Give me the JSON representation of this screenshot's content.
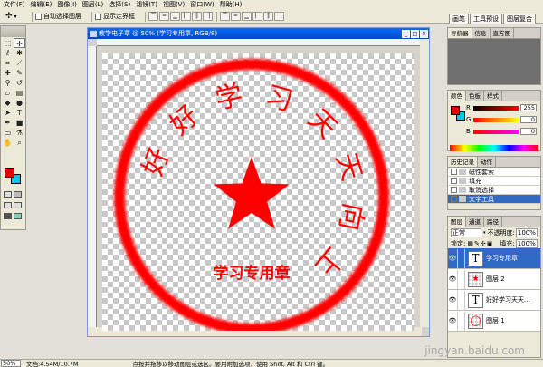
{
  "menubar": {
    "items": [
      "文件(F)",
      "编辑(E)",
      "图像(I)",
      "图层(L)",
      "选择(S)",
      "滤镜(T)",
      "视图(V)",
      "窗口(W)",
      "帮助(H)"
    ]
  },
  "options": {
    "auto_select_label": "自动选择图层",
    "show_bounds_label": "显示定界框"
  },
  "well": {
    "tabs": [
      "画笔",
      "工具预设",
      "图层复合"
    ]
  },
  "document": {
    "title": "教学电子章 @ 50% (学习专用章, RGB/8)",
    "seal": {
      "arc_text": "好好学习天天向上",
      "inner_text": "学习专用章",
      "color": "#ff0000"
    }
  },
  "navigator": {
    "tabs": [
      "导航器",
      "信息",
      "直方图"
    ]
  },
  "color_panel": {
    "tabs": [
      "颜色",
      "色板",
      "样式"
    ],
    "fg": "#e60000",
    "bg": "#00c8e8",
    "r_label": "R",
    "g_label": "G",
    "b_label": "B",
    "r": "255",
    "g": "0",
    "b": "0"
  },
  "history": {
    "tabs": [
      "历史记录",
      "动作"
    ],
    "items": [
      "磁性套索",
      "填充",
      "取消选择",
      "文字工具"
    ]
  },
  "layers": {
    "tabs": [
      "图层",
      "通道",
      "路径"
    ],
    "blend_mode": "正常",
    "opacity_label": "不透明度:",
    "opacity": "100%",
    "lock_label": "锁定:",
    "fill_label": "填充:",
    "fill": "100%",
    "items": [
      {
        "name": "学习专用章",
        "type": "T"
      },
      {
        "name": "图层 2",
        "type": "star"
      },
      {
        "name": "好好学习天天...",
        "type": "T"
      },
      {
        "name": "图层 1",
        "type": "ring"
      }
    ]
  },
  "status": {
    "zoom": "50%",
    "doc_size": "文档:4.54M/10.7M",
    "tip": "点按并拖移以移动图层或选区。要用附加选项，使用 Shift, Alt 和 Ctrl 键。"
  },
  "watermark": "jingyan.baidu.com"
}
